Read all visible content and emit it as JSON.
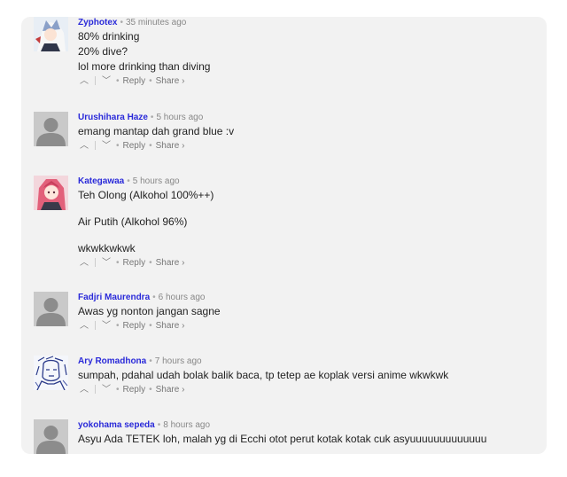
{
  "comments": [
    {
      "author": "Zyphotex",
      "time": "35 minutes ago",
      "avatar": "anime-avatar",
      "paragraphs": [
        "80% drinking",
        "20% dive?",
        "lol more drinking than diving"
      ],
      "reply_label": "Reply",
      "share_label": "Share ›"
    },
    {
      "author": "Urushihara Haze",
      "time": "5 hours ago",
      "avatar": "default-avatar",
      "paragraphs": [
        "emang mantap dah grand blue :v"
      ],
      "reply_label": "Reply",
      "share_label": "Share ›"
    },
    {
      "author": "Kategawaa",
      "time": "5 hours ago",
      "avatar": "anime-avatar",
      "paragraphs": [
        "Teh Olong (Alkohol 100%++)",
        "Air Putih (Alkohol 96%)",
        "wkwkkwkwk"
      ],
      "reply_label": "Reply",
      "share_label": "Share ›"
    },
    {
      "author": "Fadjri Maurendra",
      "time": "6 hours ago",
      "avatar": "default-avatar",
      "paragraphs": [
        "Awas yg nonton jangan sagne"
      ],
      "reply_label": "Reply",
      "share_label": "Share ›"
    },
    {
      "author": "Ary Romadhona",
      "time": "7 hours ago",
      "avatar": "sketch-avatar",
      "paragraphs": [
        "sumpah, pdahal udah bolak balik baca, tp tetep ae koplak versi anime wkwkwk"
      ],
      "reply_label": "Reply",
      "share_label": "Share ›"
    },
    {
      "author": "yokohama sepeda",
      "time": "8 hours ago",
      "avatar": "default-avatar",
      "paragraphs": [
        "Asyu Ada TETEK loh, malah yg di Ecchi otot perut kotak kotak cuk asyuuuuuuuuuuuuu"
      ],
      "reply_label": "Reply",
      "share_label": "Share ›"
    }
  ],
  "icons": {
    "upvote": "▲",
    "downvote": "▼",
    "separator_dot": "•"
  }
}
